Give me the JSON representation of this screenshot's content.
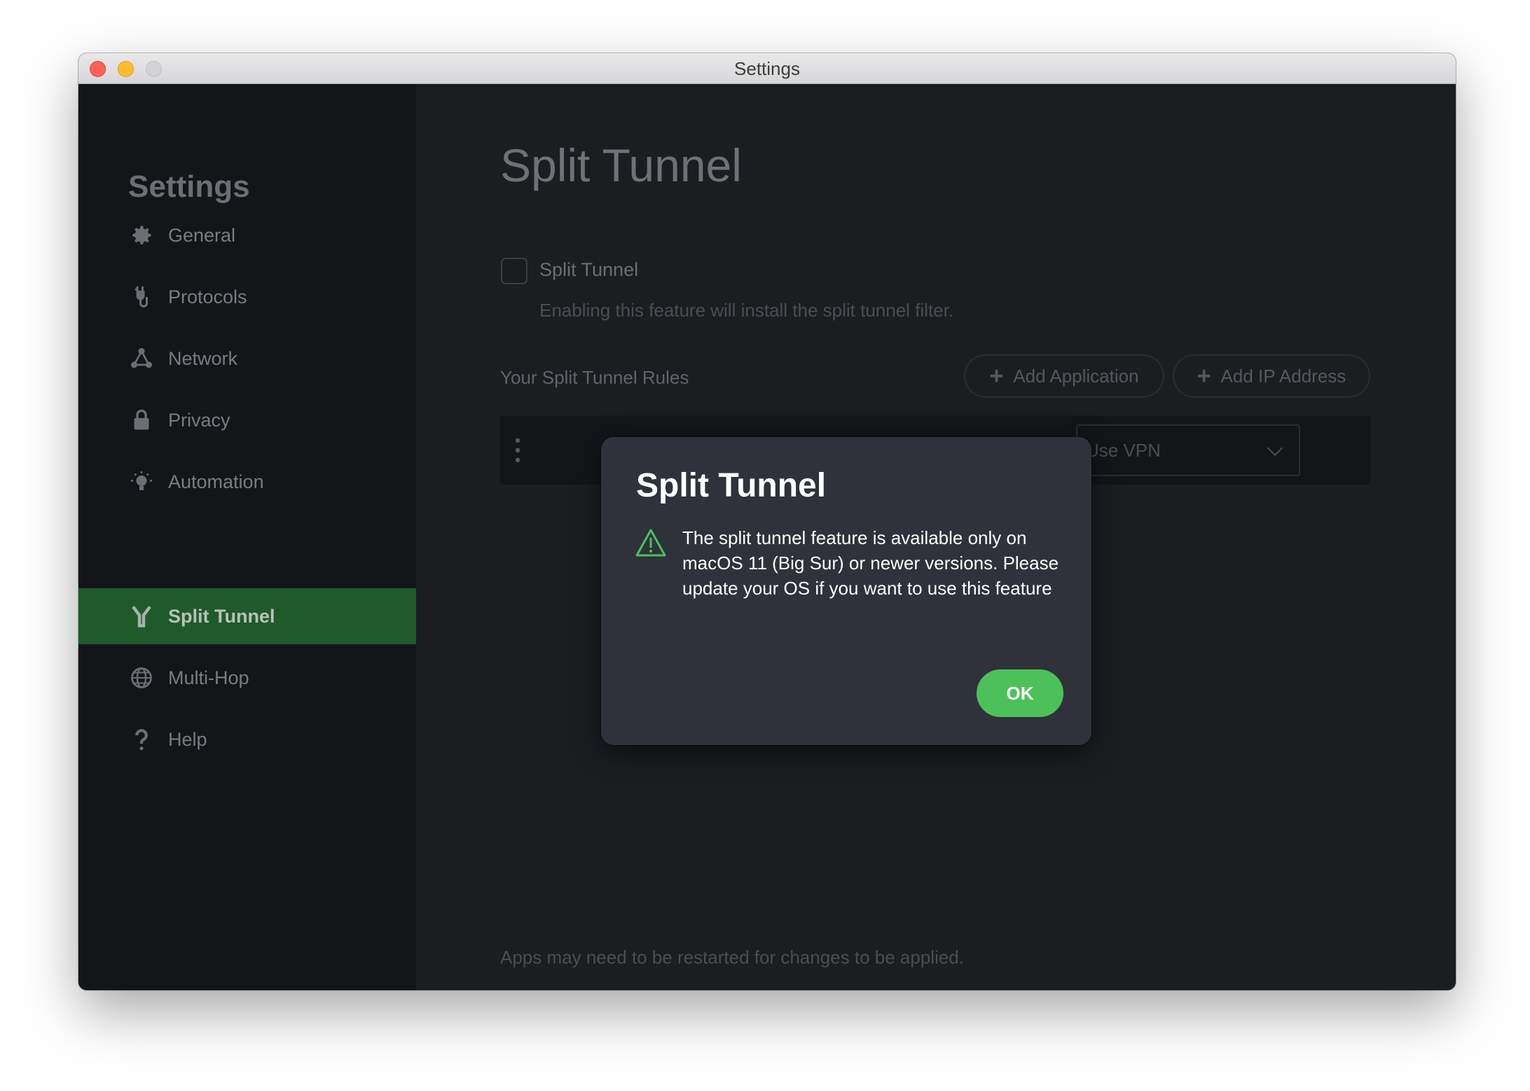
{
  "window": {
    "title": "Settings"
  },
  "sidebar": {
    "title": "Settings",
    "items": [
      {
        "label": "General",
        "icon": "gear-icon"
      },
      {
        "label": "Protocols",
        "icon": "plug-icon"
      },
      {
        "label": "Network",
        "icon": "network-icon"
      },
      {
        "label": "Privacy",
        "icon": "lock-icon"
      },
      {
        "label": "Automation",
        "icon": "lightbulb-icon"
      },
      {
        "label": "Split Tunnel",
        "icon": "split-icon",
        "active": true
      },
      {
        "label": "Multi-Hop",
        "icon": "globe-icon"
      },
      {
        "label": "Help",
        "icon": "question-icon"
      }
    ]
  },
  "main": {
    "title": "Split Tunnel",
    "checkbox_label": "Split Tunnel",
    "checkbox_checked": false,
    "checkbox_description": "Enabling this feature will install the split tunnel filter.",
    "rules_label": "Your Split Tunnel Rules",
    "add_application_label": "Add Application",
    "add_ip_label": "Add IP Address",
    "rule_select_value": "Use VPN",
    "footer_note": "Apps may need to be restarted for changes to be applied."
  },
  "dialog": {
    "title": "Split Tunnel",
    "message": "The split tunnel feature is available only on macOS 11 (Big Sur) or newer versions. Please update your OS if you want to use this feature",
    "ok_label": "OK"
  },
  "colors": {
    "accent_green": "#4cc15a",
    "active_nav": "#1f5a2a",
    "warning_icon": "#4cc15a"
  }
}
